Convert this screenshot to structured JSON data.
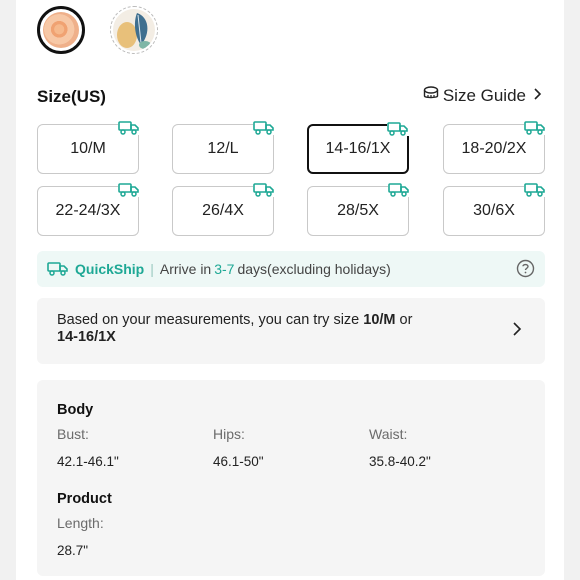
{
  "section": {
    "title": "Size(US)",
    "size_guide_label": "Size Guide"
  },
  "swatches": [
    {
      "name": "orange-abstract",
      "selected": true
    },
    {
      "name": "leaf-pattern",
      "selected": false
    }
  ],
  "sizes": [
    {
      "label": "10/M",
      "selected": false,
      "quickship": true
    },
    {
      "label": "12/L",
      "selected": false,
      "quickship": true
    },
    {
      "label": "14-16/1X",
      "selected": true,
      "quickship": true
    },
    {
      "label": "18-20/2X",
      "selected": false,
      "quickship": true
    },
    {
      "label": "22-24/3X",
      "selected": false,
      "quickship": true
    },
    {
      "label": "26/4X",
      "selected": false,
      "quickship": true
    },
    {
      "label": "28/5X",
      "selected": false,
      "quickship": true
    },
    {
      "label": "30/6X",
      "selected": false,
      "quickship": true
    }
  ],
  "quickship": {
    "label": "QuickShip",
    "separator": "|",
    "text_before": "Arrive in",
    "days": "3-7",
    "text_after": "days(excluding holidays)"
  },
  "recommendation": {
    "text_before": "Based on your measurements, you can try size",
    "size_a": "10/M",
    "conjunction": "or",
    "size_b": "14-16/1X"
  },
  "body": {
    "heading": "Body",
    "bust_label": "Bust:",
    "bust_value": "42.1-46.1\"",
    "hips_label": "Hips:",
    "hips_value": "46.1-50\"",
    "waist_label": "Waist:",
    "waist_value": "35.8-40.2\""
  },
  "product": {
    "heading": "Product",
    "length_label": "Length:",
    "length_value": "28.7\""
  },
  "colors": {
    "accent": "#1ea895",
    "quickship_bg": "#eef8f6",
    "selected_border": "#111111"
  }
}
